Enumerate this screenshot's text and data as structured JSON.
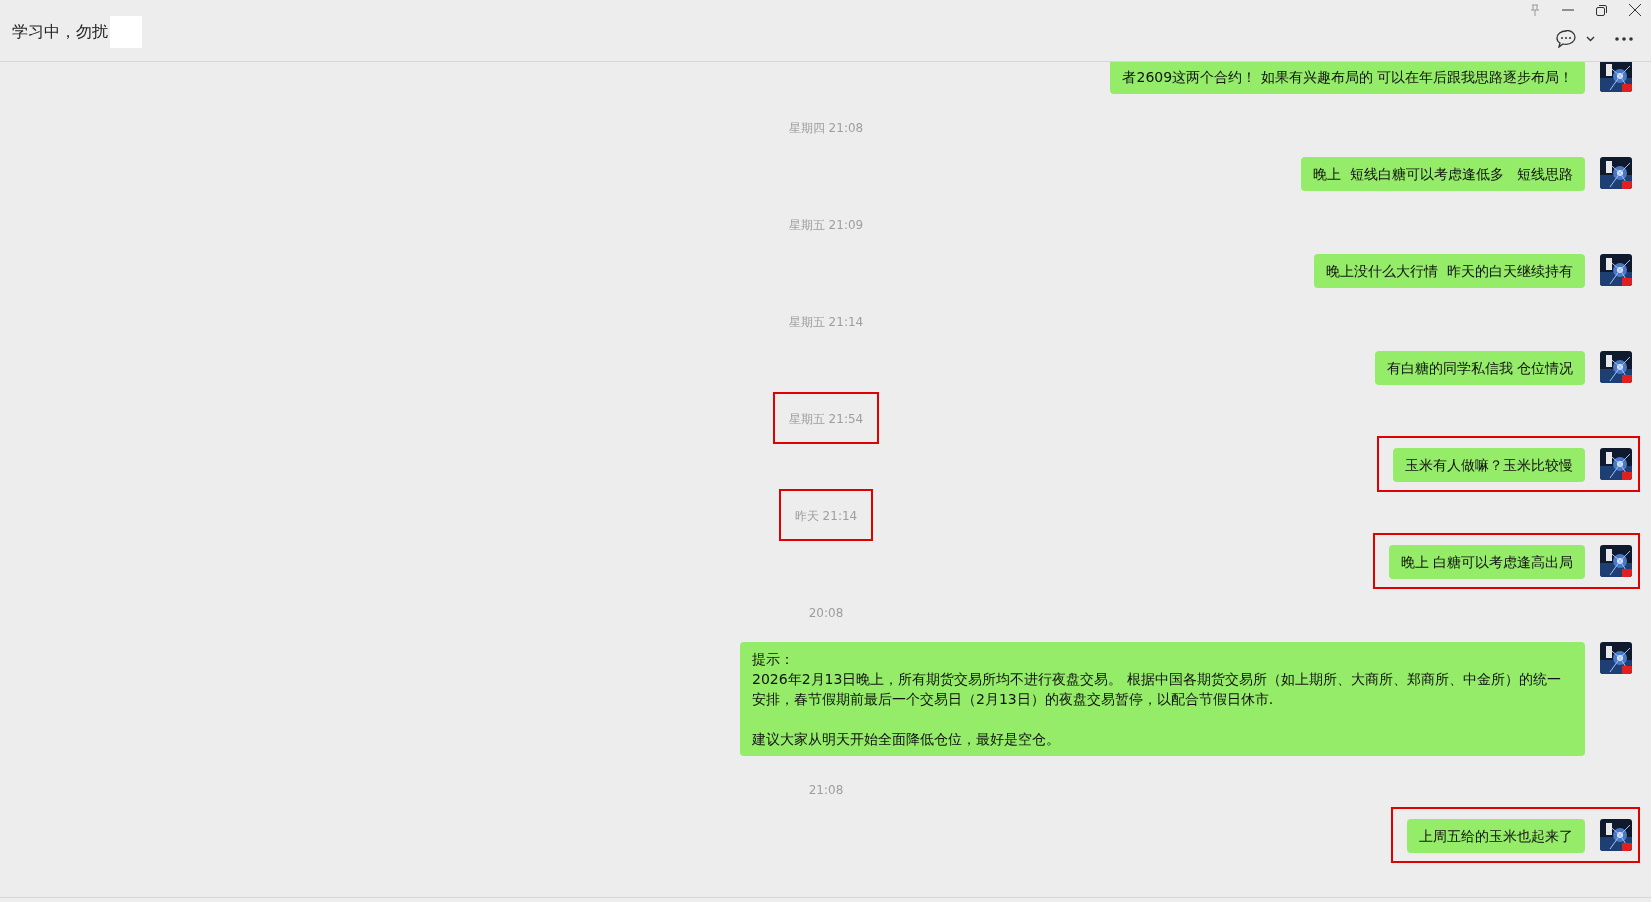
{
  "window": {
    "title": "学习中，勿扰"
  },
  "messages": [
    {
      "kind": "message",
      "text": "者2609这两个合约！ 如果有兴趣布局的 可以在年后跟我思路逐步布局！",
      "highlighted": false
    },
    {
      "kind": "time",
      "text": "星期四 21:08",
      "highlighted": false
    },
    {
      "kind": "message",
      "text": "晚上  短线白糖可以考虑逢低多   短线思路",
      "highlighted": false
    },
    {
      "kind": "time",
      "text": "星期五 21:09",
      "highlighted": false
    },
    {
      "kind": "message",
      "text": "晚上没什么大行情  昨天的白天继续持有",
      "highlighted": false
    },
    {
      "kind": "time",
      "text": "星期五 21:14",
      "highlighted": false
    },
    {
      "kind": "message",
      "text": "有白糖的同学私信我 仓位情况",
      "highlighted": false
    },
    {
      "kind": "time",
      "text": "星期五 21:54",
      "highlighted": true
    },
    {
      "kind": "message",
      "text": "玉米有人做嘛？玉米比较慢",
      "highlighted": true
    },
    {
      "kind": "time",
      "text": "昨天 21:14",
      "highlighted": true
    },
    {
      "kind": "message",
      "text": "晚上 白糖可以考虑逢高出局",
      "highlighted": true
    },
    {
      "kind": "time",
      "text": "20:08",
      "highlighted": false
    },
    {
      "kind": "message",
      "text": "提示：\n2026年2月13日晚上，所有期货交易所均不进行夜盘交易。 根据中国各期货交易所（如上期所、大商所、郑商所、中金所）的统一安排，春节假期前最后一个交易日（2月13日）的夜盘交易暂停，以配合节假日休市.\n\n建议大家从明天开始全面降低仓位，最好是空仓。",
      "highlighted": false
    },
    {
      "kind": "time",
      "text": "21:08",
      "highlighted": false
    },
    {
      "kind": "message",
      "text": "上周五给的玉米也起来了",
      "highlighted": true
    }
  ]
}
